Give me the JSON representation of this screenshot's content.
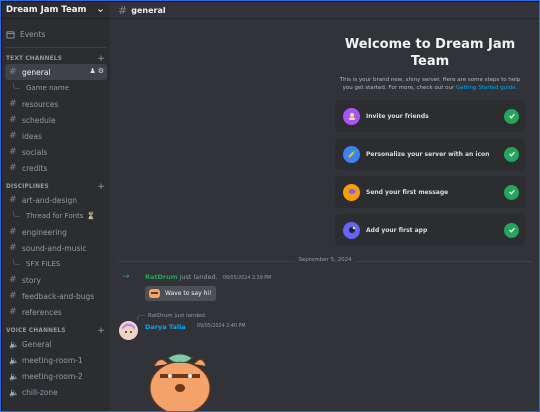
{
  "server": {
    "name": "Dream Jam Team"
  },
  "sidebar": {
    "events_label": "Events",
    "categories": {
      "text": "TEXT CHANNELS",
      "disciplines": "DISCIPLINES",
      "voice": "VOICE CHANNELS"
    },
    "text_channels": [
      {
        "name": "general",
        "active": true
      },
      {
        "thread": "Game name"
      },
      {
        "name": "resources"
      },
      {
        "name": "schedule"
      },
      {
        "name": "ideas"
      },
      {
        "name": "socials"
      },
      {
        "name": "credits"
      }
    ],
    "discipline_channels": {
      "art_and_design": "art-and-design",
      "thread_fonts": "Thread for Fonts",
      "engineering": "engineering",
      "sound_and_music": "sound-and-music",
      "sfx_files": "SFX FILES",
      "story": "story",
      "feedback_and_bugs": "feedback-and-bugs",
      "references": "references"
    },
    "voice_channels": [
      "General",
      "meeting-room-1",
      "meeting-room-2",
      "chill-zone"
    ]
  },
  "channel_header": {
    "name": "general"
  },
  "welcome": {
    "title": "Welcome to Dream Jam Team",
    "description": "This is your brand new, shiny server. Here are some steps to help you get started. For more, check out our",
    "link": "Getting Started guide.",
    "tasks": [
      {
        "label": "Invite your friends",
        "color": "#a855f7",
        "done": true
      },
      {
        "label": "Personalize your server with an icon",
        "color": "#3b82f6",
        "done": true
      },
      {
        "label": "Send your first message",
        "color": "#f59e0b",
        "done": true
      },
      {
        "label": "Add your first app",
        "color": "#6366f1",
        "done": true
      }
    ]
  },
  "date_divider": "September 5, 2024",
  "messages": {
    "join": {
      "user": "RatDrum",
      "text": "just landed.",
      "time": "09/05/2024 2:39 PM",
      "wave_button": "Wave to say hi!"
    },
    "reply": {
      "reply_user": "RatDrum",
      "reply_text": "just landed.",
      "user": "Darya Talia",
      "time": "09/05/2024 2:40 PM"
    }
  },
  "colors": {
    "accent_green": "#23a55a",
    "link_blue": "#00a8fc",
    "sidebar_bg": "#2b2d31",
    "main_bg": "#313338"
  }
}
